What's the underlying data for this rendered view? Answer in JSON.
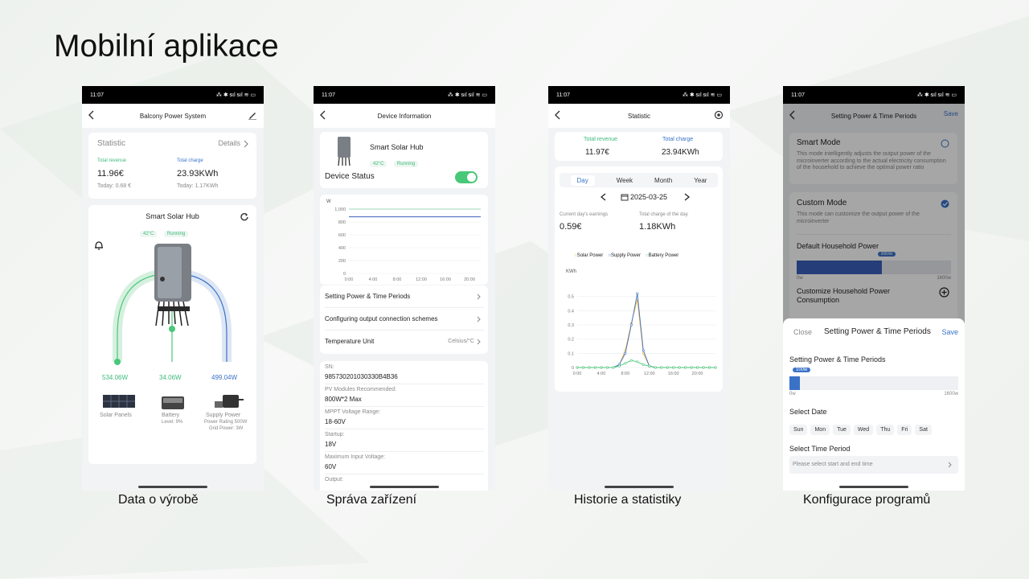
{
  "slide": {
    "title": "Mobilní aplikace",
    "captions": [
      "Data o výrobě",
      "Správa zařízení",
      "Historie a statistiky",
      "Konfigurace programů"
    ]
  },
  "status": {
    "time": "11:07",
    "icons": "⁂ ✱ ᵴıl ᵴıl ≋ ▭"
  },
  "screen1": {
    "title": "Balcony Power System",
    "statistic_label": "Statistic",
    "details_label": "Details",
    "revenue_label": "Total revenue",
    "revenue_value": "11.96€",
    "revenue_today": "Today:  0.68 €",
    "charge_label": "Total charge",
    "charge_value": "23.93KWh",
    "charge_today": "Today:  1.17KWh",
    "hub_name": "Smart Solar Hub",
    "temp": "42°C",
    "state": "Running",
    "flow_solar": "534.06W",
    "flow_battery": "34.06W",
    "flow_supply": "499.04W",
    "solar_label": "Solar Panels",
    "battery_label": "Battery",
    "battery_sub": "Level: 9%",
    "supply_label": "Supply Power",
    "supply_sub": "Power Rating 500W",
    "supply_sub2": "Grid Power: 3W"
  },
  "screen2": {
    "title": "Device Information",
    "device_name": "Smart Solar Hub",
    "temp": "42°C",
    "state": "Running",
    "device_status_label": "Device Status",
    "chart_unit": "W",
    "y_ticks": [
      "1,000",
      "800",
      "600",
      "400",
      "200",
      "0"
    ],
    "x_ticks": [
      "0:00",
      "4:00",
      "8:00",
      "12:00",
      "16:00",
      "20:00"
    ],
    "menu": [
      "Setting Power & Time Periods",
      "Configuring output connection schemes",
      "Temperature Unit"
    ],
    "temp_unit_value": "Celsius/°C",
    "sn_label": "SN:",
    "sn_value": "985730201030330B4B36",
    "pv_label": "PV Modules Recommended:",
    "pv_value": "800W*2 Max",
    "mppt_label": "MPPT Voltage Range:",
    "mppt_value": "18-60V",
    "startup_label": "Startup:",
    "startup_value": "18V",
    "maxv_label": "Maximum Input Voltage:",
    "maxv_value": "60V",
    "output_label": "Output:"
  },
  "screen3": {
    "title": "Statistic",
    "revenue_label": "Total revenue",
    "revenue_value": "11.97€",
    "charge_label": "Total charge",
    "charge_value": "23.94KWh",
    "tabs": [
      "Day",
      "Week",
      "Month",
      "Year"
    ],
    "date": "2025-03-25",
    "earn_label": "Current day's earnings",
    "earn_value": "0.59€",
    "daycharge_label": "Total charge of the day",
    "daycharge_value": "1.18KWh",
    "legend": [
      "Solar Power",
      "Supply Power",
      "Battery Power"
    ]
  },
  "screen4": {
    "title": "Setting Power & Time Periods",
    "save": "Save",
    "smart_mode": "Smart Mode",
    "smart_desc": "This mode intelligently adjusts the output power of the microinverter according to the actual electricity consumption of the household to achieve the optimal power ratio",
    "custom_mode": "Custom Mode",
    "custom_desc": "This mode can customize the output power of the microinverter",
    "default_power_label": "Default Household Power",
    "default_power_value": "880w",
    "default_min": "0w",
    "default_max": "1600w",
    "customize_label": "Customize Household Power Consumption",
    "sheet_close": "Close",
    "sheet_title": "Setting Power & Time Periods",
    "sheet_save": "Save",
    "sheet_section": "Setting Power & Time Periods",
    "sheet_power_value": "100w",
    "sheet_min": "0w",
    "sheet_max": "1600w",
    "select_date": "Select Date",
    "days": [
      "Sun",
      "Mon",
      "Tue",
      "Wed",
      "Thu",
      "Fri",
      "Sat"
    ],
    "select_time": "Select Time Period",
    "time_placeholder": "Please select start and end time"
  },
  "chart_data": [
    {
      "type": "line",
      "title": "",
      "ylabel": "W",
      "x": [
        "0:00",
        "4:00",
        "8:00",
        "12:00",
        "16:00",
        "20:00"
      ],
      "ylim": [
        0,
        1000
      ],
      "series": [
        {
          "values": [
            1000,
            1000,
            1000,
            1000,
            1000,
            1000
          ],
          "color": "#9fd8b4"
        },
        {
          "values": [
            880,
            880,
            880,
            880,
            880,
            880
          ],
          "color": "#3a5fb8"
        }
      ]
    },
    {
      "type": "line",
      "ylabel": "KWh",
      "x": [
        "0:00",
        "1:00",
        "2:00",
        "3:00",
        "4:00",
        "5:00",
        "6:00",
        "7:00",
        "8:00",
        "9:00",
        "10:00",
        "11:00",
        "12:00",
        "13:00",
        "14:00",
        "15:00",
        "16:00",
        "17:00",
        "18:00",
        "19:00",
        "20:00",
        "21:00",
        "22:00",
        "23:00"
      ],
      "x_ticks": [
        "0:00",
        "4:00",
        "8:00",
        "12:00",
        "16:00",
        "20:00"
      ],
      "ylim": [
        0,
        0.6
      ],
      "y_ticks": [
        "0.5",
        "0.4",
        "0.3",
        "0.2",
        "0.1",
        "0"
      ],
      "series": [
        {
          "name": "Solar Power",
          "color": "#f0b23c",
          "values": [
            0,
            0,
            0,
            0,
            0,
            0,
            0,
            0.02,
            0.12,
            0.31,
            0.48,
            0.1,
            0.01,
            0,
            0,
            0,
            0,
            0,
            0,
            0,
            0,
            0,
            0,
            0
          ]
        },
        {
          "name": "Supply Power",
          "color": "#3a72c8",
          "values": [
            0,
            0,
            0,
            0,
            0,
            0,
            0,
            0.02,
            0.1,
            0.3,
            0.52,
            0.12,
            0.01,
            0,
            0,
            0,
            0,
            0,
            0,
            0,
            0,
            0,
            0,
            0
          ]
        },
        {
          "name": "Battery Power",
          "color": "#48c878",
          "values": [
            0,
            0,
            0,
            0,
            0,
            0,
            0,
            0.01,
            0.03,
            0.05,
            0.04,
            0.02,
            0.01,
            0,
            0,
            0,
            0,
            0,
            0,
            0,
            0,
            0,
            0,
            0
          ]
        }
      ]
    }
  ]
}
